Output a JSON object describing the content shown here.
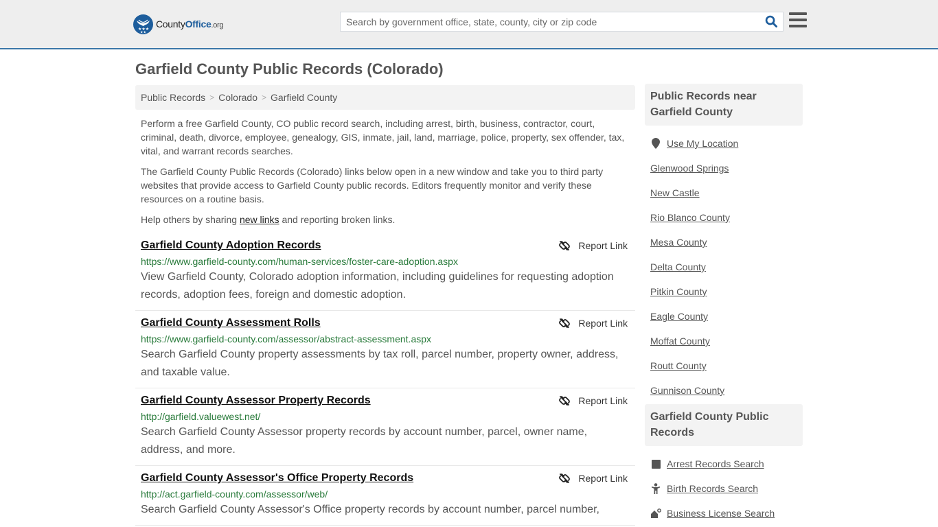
{
  "header": {
    "logo": {
      "name": "County",
      "office": "Office",
      "tld": ".org"
    },
    "search": {
      "placeholder": "Search by government office, state, county, city or zip code",
      "value": ""
    },
    "icons": {
      "search": "search-icon",
      "menu": "hamburger-menu-icon"
    }
  },
  "page": {
    "title": "Garfield County Public Records (Colorado)"
  },
  "breadcrumb": [
    {
      "label": "Public Records"
    },
    {
      "label": "Colorado"
    },
    {
      "label": "Garfield County"
    }
  ],
  "breadcrumb_separator": ">",
  "intro": {
    "p1": "Perform a free Garfield County, CO public record search, including arrest, birth, business, contractor, court, criminal, death, divorce, employee, genealogy, GIS, inmate, jail, land, marriage, police, property, sex offender, tax, vital, and warrant records searches.",
    "p2": "The Garfield County Public Records (Colorado) links below open in a new window and take you to third party websites that provide access to Garfield County public records. Editors frequently monitor and verify these resources on a routine basis.",
    "p3_before": "Help others by sharing ",
    "p3_link": "new links",
    "p3_after": " and reporting broken links."
  },
  "records": [
    {
      "title": "Garfield County Adoption Records",
      "url": "https://www.garfield-county.com/human-services/foster-care-adoption.aspx",
      "description": "View Garfield County, Colorado adoption information, including guidelines for requesting adoption records, adoption fees, foreign and domestic adoption.",
      "report_label": "Report Link"
    },
    {
      "title": "Garfield County Assessment Rolls",
      "url": "https://www.garfield-county.com/assessor/abstract-assessment.aspx",
      "description": "Search Garfield County property assessments by tax roll, parcel number, property owner, address, and taxable value.",
      "report_label": "Report Link"
    },
    {
      "title": "Garfield County Assessor Property Records",
      "url": "http://garfield.valuewest.net/",
      "description": "Search Garfield County Assessor property records by account number, parcel, owner name, address, and more.",
      "report_label": "Report Link"
    },
    {
      "title": "Garfield County Assessor's Office Property Records",
      "url": "http://act.garfield-county.com/assessor/web/",
      "description": "Search Garfield County Assessor's Office property records by account number, parcel number,",
      "report_label": "Report Link"
    }
  ],
  "sidebar": {
    "nearby": {
      "heading": "Public Records near Garfield County",
      "use_location": "Use My Location",
      "links": [
        "Glenwood Springs",
        "New Castle",
        "Rio Blanco County",
        "Mesa County",
        "Delta County",
        "Pitkin County",
        "Eagle County",
        "Moffat County",
        "Routt County",
        "Gunnison County"
      ]
    },
    "county_records": {
      "heading": "Garfield County Public Records",
      "links": [
        {
          "label": "Arrest Records Search",
          "icon": "square-icon"
        },
        {
          "label": "Birth Records Search",
          "icon": "child-icon"
        },
        {
          "label": "Business License Search",
          "icon": "business-gear-icon"
        }
      ]
    }
  },
  "colors": {
    "brand_blue": "#1d5d9c",
    "header_border": "#3b77a8",
    "url_green": "#287a3a",
    "header_bg": "#eeeeee"
  }
}
